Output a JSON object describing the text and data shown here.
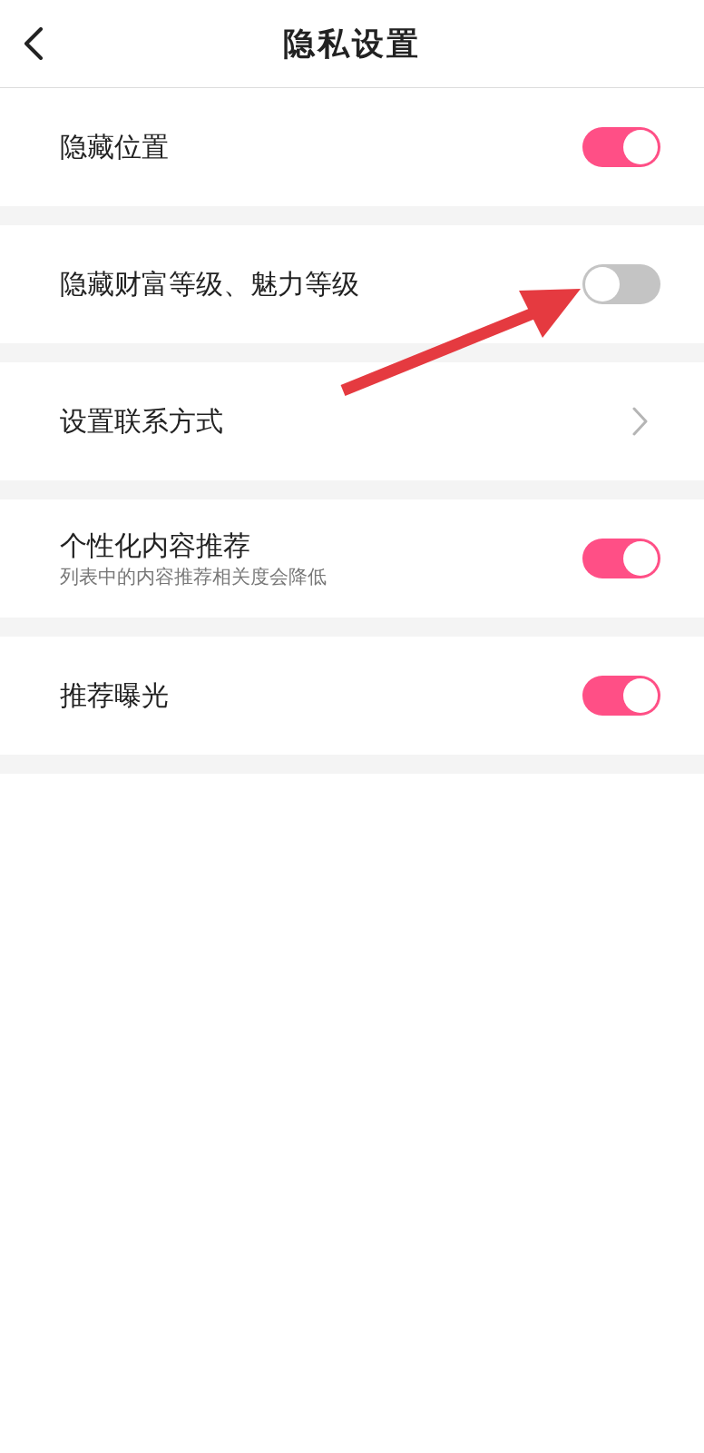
{
  "header": {
    "title": "隐私设置"
  },
  "sections": [
    {
      "kind": "toggle",
      "label": "隐藏位置",
      "on": true
    },
    {
      "kind": "toggle",
      "label": "隐藏财富等级、魅力等级",
      "on": false
    },
    {
      "kind": "link",
      "label": "设置联系方式"
    },
    {
      "kind": "toggle",
      "label": "个性化内容推荐",
      "subtitle": "列表中的内容推荐相关度会降低",
      "on": true
    },
    {
      "kind": "toggle",
      "label": "推荐曝光",
      "on": true
    }
  ]
}
